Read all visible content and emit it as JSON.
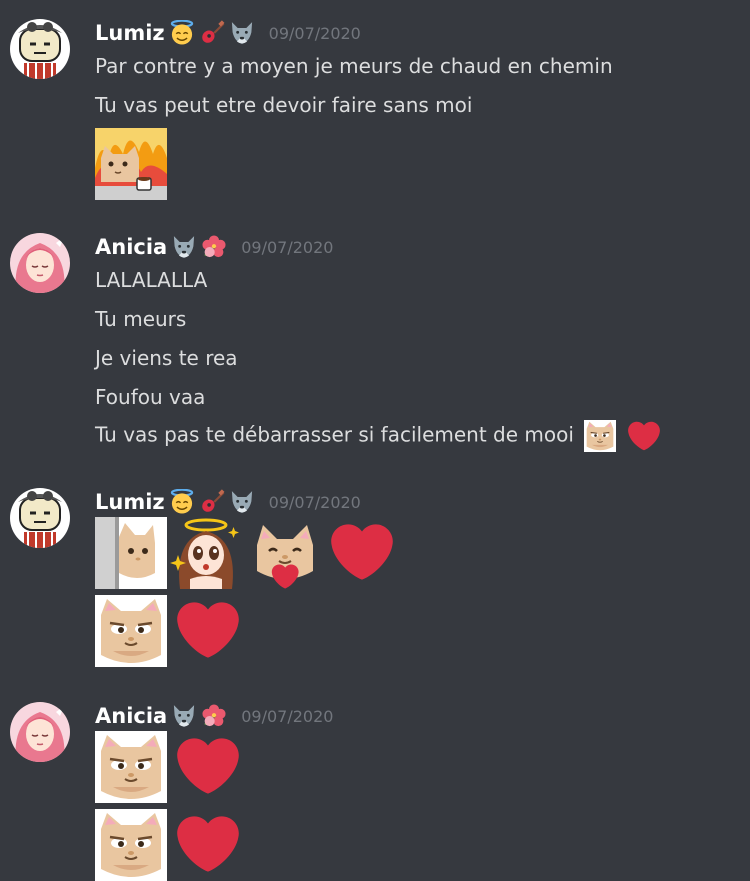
{
  "messages": [
    {
      "author": "Lumiz",
      "timestamp": "09/07/2020",
      "lines": [
        "Par contre y a moyen je meurs de chaud en chemin",
        "Tu vas peut etre devoir faire sans moi"
      ],
      "emojis": [
        "cat-fire-coffee-emoji"
      ]
    },
    {
      "author": "Anicia",
      "timestamp": "09/07/2020",
      "lines": [
        "LALALALLA",
        "Tu meurs",
        "Je viens te rea",
        "Foufou vaa",
        "Tu vas pas te débarrasser si facilement de mooi"
      ]
    },
    {
      "author": "Lumiz",
      "timestamp": "09/07/2020",
      "emojis": [
        "cat-peek-emoji",
        "angel-girl-emoji",
        "cat-heart-emoji",
        "red-heart-emoji",
        "cat-smirk-emoji",
        "red-heart-emoji"
      ]
    },
    {
      "author": "Anicia",
      "timestamp": "09/07/2020",
      "emojis": [
        "cat-smirk-emoji",
        "red-heart-emoji",
        "cat-smirk-emoji",
        "red-heart-emoji"
      ]
    }
  ],
  "colors": {
    "background": "#36393f",
    "username": "#ffffff",
    "text": "#dcddde",
    "timestamp": "#72767d",
    "heart": "#dd2e44"
  },
  "badges": {
    "lumiz": [
      "smiling-face-with-halo-icon",
      "guitar-icon",
      "wolf-icon"
    ],
    "anicia": [
      "wolf-icon",
      "hibiscus-icon"
    ]
  }
}
